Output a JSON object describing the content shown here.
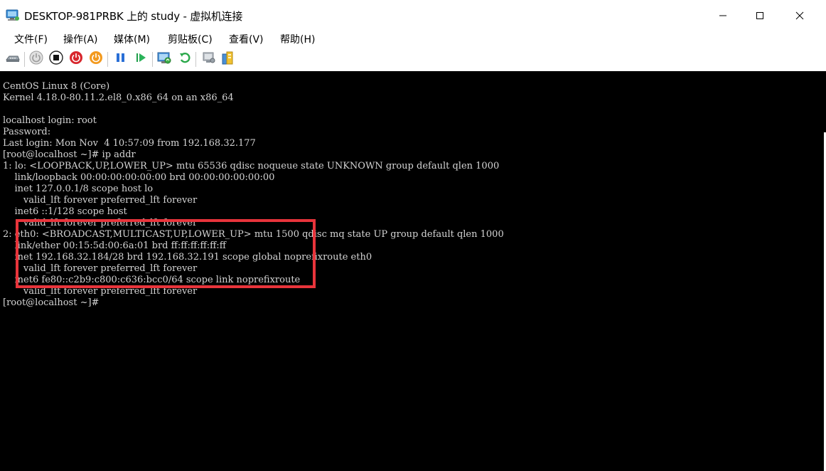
{
  "window": {
    "title": "DESKTOP-981PRBK 上的 study - 虚拟机连接",
    "icon": "vm-monitor-icon",
    "controls": [
      "minimize-icon",
      "maximize-icon",
      "close-icon"
    ]
  },
  "menu": {
    "items": [
      "文件(F)",
      "操作(A)",
      "媒体(M)",
      "剪贴板(C)",
      "查看(V)",
      "帮助(H)"
    ]
  },
  "toolbar": {
    "buttons": [
      "ctrl-alt-del-icon",
      "start-icon",
      "turn-off-icon",
      "shut-down-icon",
      "power-icon",
      "pause-icon",
      "play-icon",
      "checkpoint-icon",
      "revert-icon",
      "settings-icon",
      "integration-icon"
    ]
  },
  "colors": {
    "console_bg": "#000000",
    "console_text": "#d4d4d4",
    "highlight": "#e8343b"
  },
  "console": {
    "lines": [
      "CentOS Linux 8 (Core)",
      "Kernel 4.18.0-80.11.2.el8_0.x86_64 on an x86_64",
      "",
      "localhost login: root",
      "Password:",
      "Last login: Mon Nov  4 10:57:09 from 192.168.32.177",
      "[root@localhost ~]# ip addr",
      "1: lo: <LOOPBACK,UP,LOWER_UP> mtu 65536 qdisc noqueue state UNKNOWN group default qlen 1000",
      "    link/loopback 00:00:00:00:00:00 brd 00:00:00:00:00:00",
      "    inet 127.0.0.1/8 scope host lo",
      "       valid_lft forever preferred_lft forever",
      "    inet6 ::1/128 scope host",
      "       valid_lft forever preferred_lft forever",
      "2: eth0: <BROADCAST,MULTICAST,UP,LOWER_UP> mtu 1500 qdisc mq state UP group default qlen 1000",
      "    link/ether 00:15:5d:00:6a:01 brd ff:ff:ff:ff:ff:ff",
      "    inet 192.168.32.184/28 brd 192.168.32.191 scope global noprefixroute eth0",
      "       valid_lft forever preferred_lft forever",
      "    inet6 fe80::c2b9:c800:c636:bcc0/64 scope link noprefixroute",
      "       valid_lft forever preferred_lft forever",
      "[root@localhost ~]#"
    ]
  }
}
